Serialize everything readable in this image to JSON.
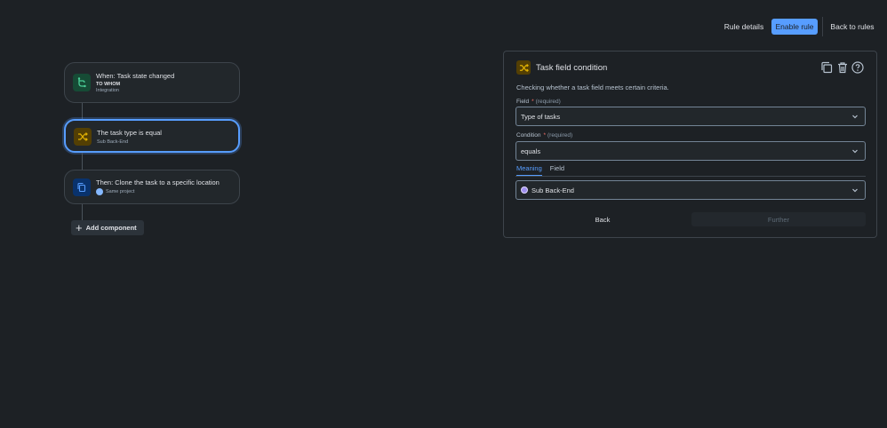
{
  "header": {
    "rule_details": "Rule details",
    "enable_rule": "Enable rule",
    "back_to_rules": "Back to rules"
  },
  "flow": {
    "trigger": {
      "title": "When: Task state changed",
      "subtitle_1": "TO WHOM",
      "subtitle_2": "Integration",
      "icon": "branch-icon",
      "color": "#4bce97"
    },
    "condition": {
      "title": "The task type is equal",
      "subtitle": "Sub Back-End",
      "icon": "shuffle-icon",
      "color": "#e2b203"
    },
    "action": {
      "title": "Then: Clone the task to a specific location",
      "subtitle": "Same project",
      "icon": "copy-icon",
      "color": "#579dff"
    },
    "add_component": "Add component"
  },
  "panel": {
    "title": "Task field condition",
    "description": "Checking whether a task field meets certain criteria.",
    "field": {
      "label": "Field",
      "required_mark": "*",
      "required_text": "(required)",
      "value": "Type of tasks"
    },
    "condition": {
      "label": "Condition",
      "required_mark": "*",
      "required_text": "(required)",
      "value": "equals"
    },
    "tabs": [
      "Meaning",
      "Field"
    ],
    "active_tab": "Meaning",
    "meaning_value": "Sub Back-End",
    "back": "Back",
    "further": "Further"
  },
  "colors": {
    "accent": "#579dff",
    "background": "#1d2125",
    "panel_icon": "#e2b203"
  }
}
